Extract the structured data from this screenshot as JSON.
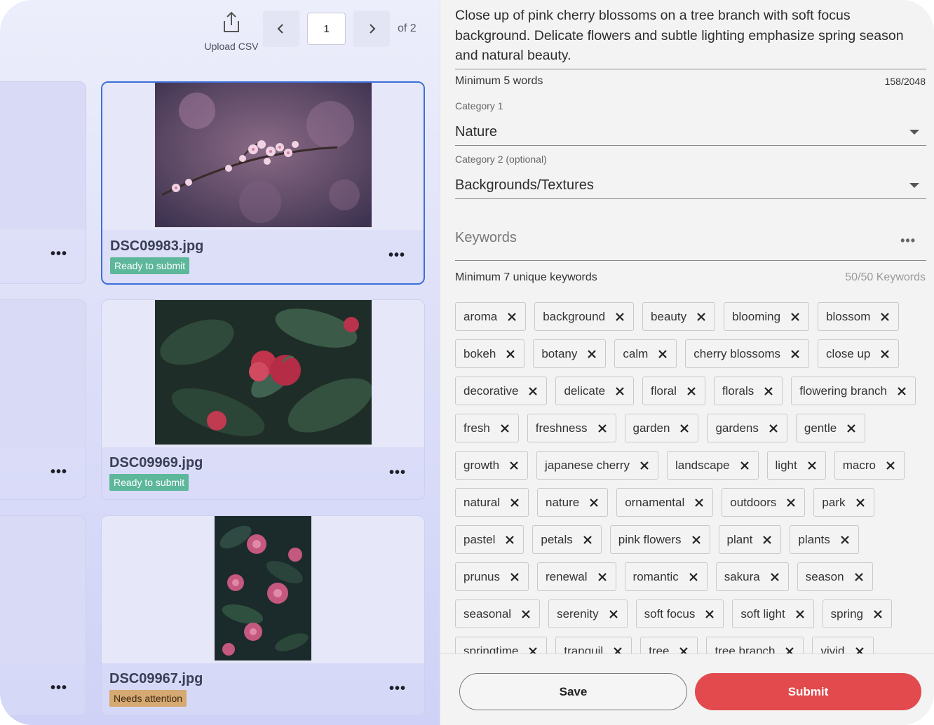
{
  "toolbar": {
    "upload_label": "Upload CSV",
    "page_value": "1",
    "page_of": "of 2"
  },
  "cards": [
    {
      "filename": "DSC09983.jpg",
      "status": "Ready to submit",
      "selected": true
    },
    {
      "filename": "DSC09969.jpg",
      "status": "Ready to submit"
    },
    {
      "filename": "DSC09967.jpg",
      "status": "Needs attention"
    }
  ],
  "editor": {
    "description": "Close up of pink cherry blossoms on a tree branch with soft focus background. Delicate flowers and subtle lighting emphasize spring season and natural beauty.",
    "description_helper": "Minimum 5 words",
    "description_count": "158/2048",
    "category1_label": "Category 1",
    "category1_value": "Nature",
    "category2_label": "Category 2 (optional)",
    "category2_value": "Backgrounds/Textures",
    "keywords_placeholder": "Keywords",
    "keywords_helper": "Minimum 7 unique keywords",
    "keywords_count": "50/50 Keywords",
    "keywords": [
      "aroma",
      "background",
      "beauty",
      "blooming",
      "blossom",
      "bokeh",
      "botany",
      "calm",
      "cherry blossoms",
      "close up",
      "decorative",
      "delicate",
      "floral",
      "florals",
      "flowering branch",
      "fresh",
      "freshness",
      "garden",
      "gardens",
      "gentle",
      "growth",
      "japanese cherry",
      "landscape",
      "light",
      "macro",
      "natural",
      "nature",
      "ornamental",
      "outdoors",
      "park",
      "pastel",
      "petals",
      "pink flowers",
      "plant",
      "plants",
      "prunus",
      "renewal",
      "romantic",
      "sakura",
      "season",
      "seasonal",
      "serenity",
      "soft focus",
      "soft light",
      "spring",
      "springtime",
      "tranquil",
      "tree",
      "tree branch",
      "vivid"
    ]
  },
  "actions": {
    "save_label": "Save",
    "submit_label": "Submit"
  },
  "colors": {
    "accent_blue": "#3c6fd9",
    "ready_green": "#5db79a",
    "attention_tan": "#d6a872",
    "submit_red": "#e24a4d"
  }
}
